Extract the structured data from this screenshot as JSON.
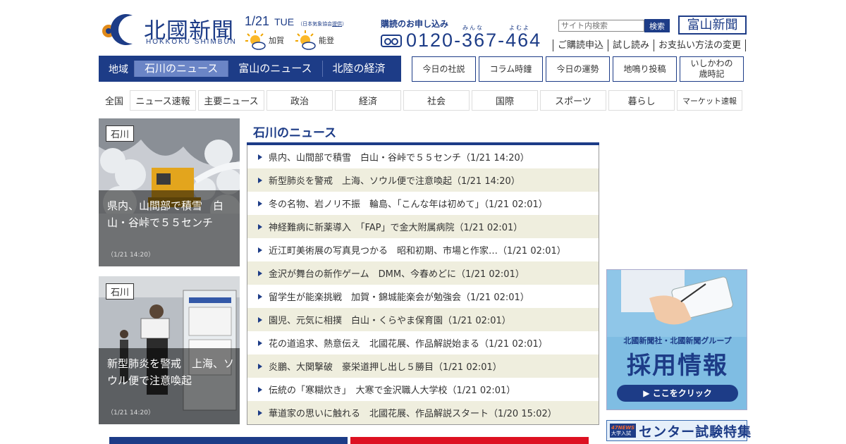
{
  "header": {
    "logo_jp": "北國新聞",
    "logo_en": "HOKKOKU SHIMBUN",
    "date": "1/21",
    "weekday": "TUE",
    "weather_note_prefix": "（日本気象協会",
    "weather_note_link": "提供",
    "weather_note_suffix": "）",
    "weather": [
      {
        "place": "加賀",
        "icon": "sun-cloud-icon"
      },
      {
        "place": "能登",
        "icon": "sun-cloud-icon"
      }
    ],
    "subscribe_label": "購読のお申し込み",
    "ruby_left": "みんな",
    "ruby_right": "よむよ",
    "phone": "0120-367-464",
    "search_placeholder": "サイト内検索",
    "search_button": "検索",
    "toyama_button": "富山新聞",
    "links": [
      "ご購読申込",
      "試し読み",
      "お支払い方法の変更"
    ]
  },
  "region_nav": {
    "label": "地域",
    "tabs": [
      {
        "label": "石川のニュース",
        "active": true
      },
      {
        "label": "富山のニュース",
        "active": false
      },
      {
        "label": "北陸の経済",
        "active": false
      }
    ]
  },
  "box_buttons": [
    "今日の社説",
    "コラム時鐘",
    "今日の運勢",
    "地鳴り投稿",
    "いしかわの\n歳時記"
  ],
  "category_nav": {
    "label": "全国",
    "items": [
      "ニュース速報",
      "主要ニュース",
      "政治",
      "経済",
      "社会",
      "国際",
      "スポーツ",
      "暮らし",
      "マーケット速報"
    ]
  },
  "cards": [
    {
      "tag": "石川",
      "headline": "県内、山間部で積雪　白山・谷峠で５５センチ",
      "time": "（1/21 14:20）"
    },
    {
      "tag": "石川",
      "headline": "新型肺炎を警戒　上海、ソウル便で注意喚起",
      "time": "（1/21 14:20）"
    }
  ],
  "news": {
    "title": "石川のニュース",
    "items": [
      "県内、山間部で積雪　白山・谷峠で５５センチ（1/21 14:20）",
      "新型肺炎を警戒　上海、ソウル便で注意喚起（1/21 14:20）",
      "冬の名物、岩ノリ不振　輪島、「こんな年は初めて」（1/21 02:01）",
      "神経難病に新薬導入　「FAP」で金大附属病院（1/21 02:01）",
      "近江町美術展の写真見つかる　昭和初期、市場と作家…（1/21 02:01）",
      "金沢が舞台の新作ゲーム　DMM、今春めどに（1/21 02:01）",
      "留学生が能楽挑戦　加賀・錦城能楽会が勉強会（1/21 02:01）",
      "園児、元気に相撲　白山・くらやま保育園（1/21 02:01）",
      "花の道追求、熱意伝え　北國花展、作品解説始まる（1/21 02:01）",
      "炎鵬、大関撃破　豪栄道押し出し５勝目（1/21 02:01）",
      "伝統の「寒糊炊き」　大寒で金沢職人大学校（1/21 02:01）",
      "華道家の思いに触れる　北國花展、作品解説スタート（1/20 15:02）"
    ]
  },
  "ads": {
    "recruit_sub": "北國新聞社・北國新聞グループ",
    "recruit_main": "採用情報",
    "recruit_button": "▶ ここをクリック",
    "exam_badge_top": "47NEWS",
    "exam_badge_bottom": "大学入試",
    "exam_title": "センター試験特集"
  },
  "colors": {
    "brand": "#1d3c87",
    "active_tab": "#6b85c6",
    "stripe": "#efeede"
  }
}
